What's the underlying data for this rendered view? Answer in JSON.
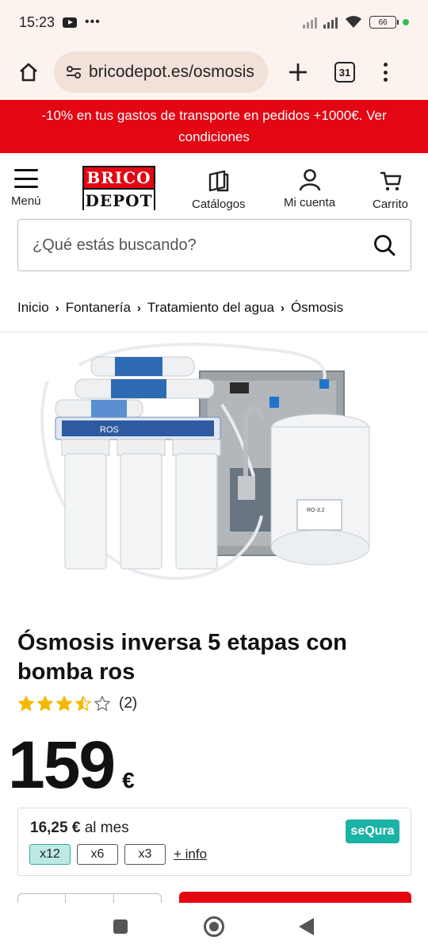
{
  "status_bar": {
    "time": "15:23",
    "battery": "66"
  },
  "browser": {
    "url": "bricodepot.es/osmosis",
    "tab_count": "31"
  },
  "promo": {
    "text": "-10% en tus gastos de transporte en pedidos +1000€. Ver condiciones"
  },
  "header": {
    "logo_top": "BRICO",
    "logo_bottom": "DEPOT",
    "menu_label": "Menú",
    "catalogs_label": "Catálogos",
    "account_label": "Mi cuenta",
    "cart_label": "Carrito"
  },
  "search": {
    "placeholder": "¿Qué estás buscando?"
  },
  "breadcrumb": [
    "Inicio",
    "Fontanería",
    "Tratamiento del agua",
    "Ósmosis"
  ],
  "product": {
    "title": "Ósmosis inversa 5 etapas con bomba ros",
    "image_label": "ROS",
    "tank_label": "RO-3.2",
    "rating": 3.5,
    "rating_max": 5,
    "rating_count": "(2)",
    "price_integer": "159",
    "price_currency": "€"
  },
  "financing": {
    "monthly_amount": "16,25 €",
    "monthly_suffix": "al mes",
    "options": [
      "x12",
      "x6",
      "x3"
    ],
    "selected_option": "x12",
    "more_info": "+ info",
    "provider": "seQura"
  },
  "colors": {
    "brand_red": "#e30613",
    "sequra_teal": "#1ab3a6",
    "star_yellow": "#f5b800"
  }
}
